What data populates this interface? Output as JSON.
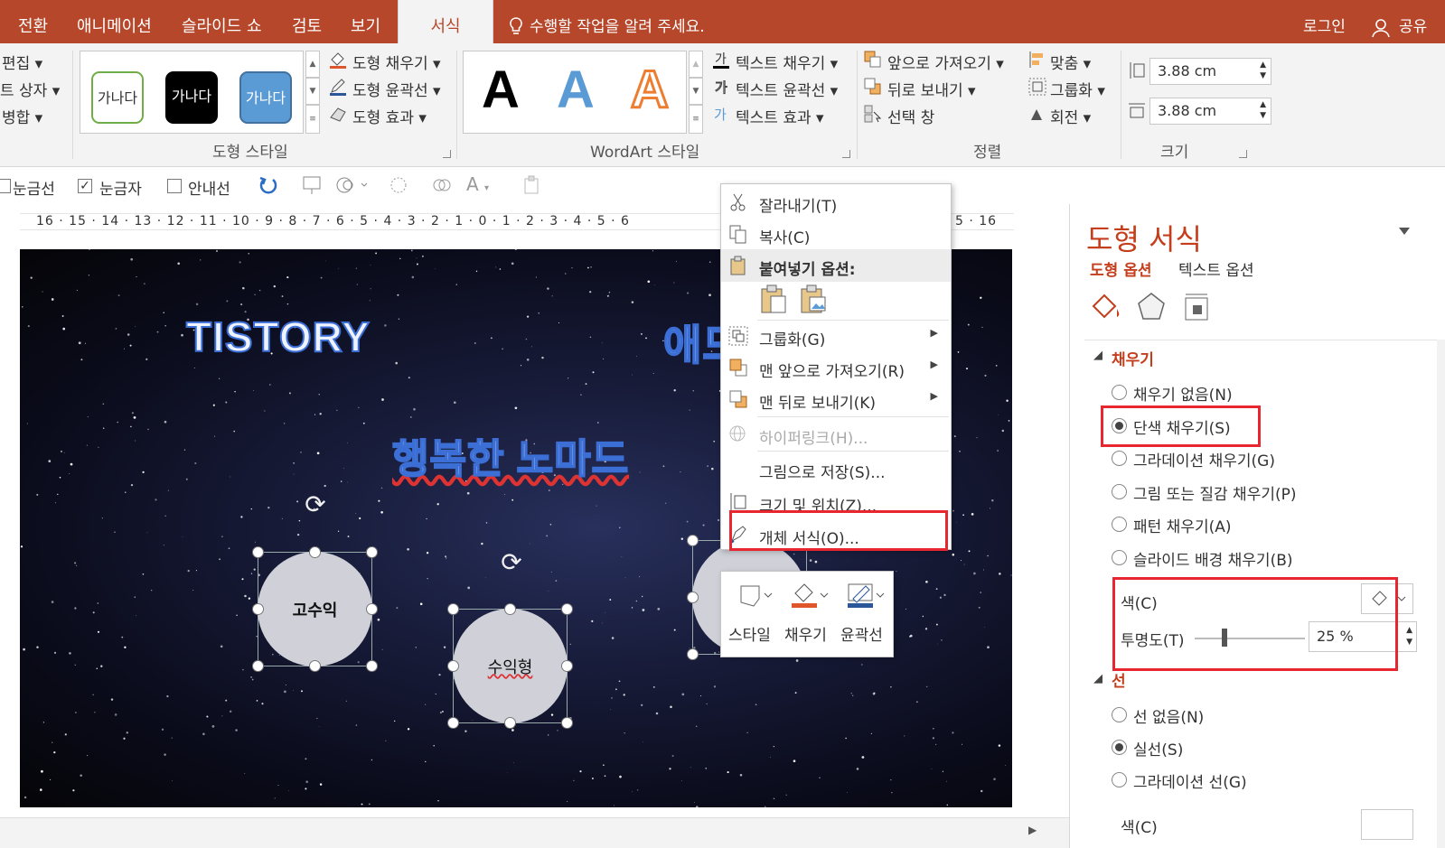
{
  "tabs": [
    "전환",
    "애니메이션",
    "슬라이드 쇼",
    "검토",
    "보기",
    "서식"
  ],
  "tell_me": "수행할 작업을 알려 주세요.",
  "login": "로그인",
  "share": "공유",
  "ribbon": {
    "left_items": [
      "편집",
      "트 상자",
      "병합"
    ],
    "shape_style_samples": [
      "가나다",
      "가나다",
      "가나다"
    ],
    "shape_cmds": [
      "도형 채우기",
      "도형 윤곽선",
      "도형 효과"
    ],
    "shape_style_label": "도형 스타일",
    "wordart_letter": "A",
    "text_cmds": [
      "텍스트 채우기",
      "텍스트 윤곽선",
      "텍스트 효과"
    ],
    "wordart_label": "WordArt 스타일",
    "arrange_cmds": [
      "앞으로 가져오기",
      "뒤로 보내기",
      "선택 창"
    ],
    "arrange_cmds2": [
      "맞춤",
      "그룹화",
      "회전"
    ],
    "arrange_label": "정렬",
    "height_value": "3.88 cm",
    "width_value": "3.88 cm",
    "size_label": "크기"
  },
  "toolbar2": {
    "gridlines": "눈금선",
    "ruler": "눈금자",
    "guides": "안내선"
  },
  "ruler_text": "16 · 15 · 14 · 13 · 12 · 11 · 10 · 9 · 8 · 7 · 6 · 5 · 4 · 3 · 2 · 1 · 0 · 1 · 2 · 3 · 4 · 5 · 6",
  "ruler_right": "5 · 16",
  "slide": {
    "title_left": "TISTORY",
    "title_right": "애드",
    "subtitle": "행복한 노마드",
    "circle1": "고수익",
    "circle2": "수익형"
  },
  "context_menu": {
    "cut": "잘라내기(T)",
    "copy": "복사(C)",
    "paste_options": "붙여넣기 옵션:",
    "group": "그룹화(G)",
    "bring_front": "맨 앞으로 가져오기(R)",
    "send_back": "맨 뒤로 보내기(K)",
    "hyperlink": "하이퍼링크(H)...",
    "save_picture": "그림으로 저장(S)...",
    "size_position": "크기 및 위치(Z)...",
    "format_object": "개체 서식(O)..."
  },
  "mini_toolbar": [
    "스타일",
    "채우기",
    "윤곽선"
  ],
  "pane": {
    "title": "도형 서식",
    "tab_shape": "도형 옵션",
    "tab_text": "텍스트 옵션",
    "fill_section": "채우기",
    "fill_options": [
      "채우기 없음(N)",
      "단색 채우기(S)",
      "그라데이션 채우기(G)",
      "그림 또는 질감 채우기(P)",
      "패턴 채우기(A)",
      "슬라이드 배경 채우기(B)"
    ],
    "color_label": "색(C)",
    "transparency_label": "투명도(T)",
    "transparency_value": "25 %",
    "line_section": "선",
    "line_options": [
      "선 없음(N)",
      "실선(S)",
      "그라데이션 선(G)"
    ],
    "line_color_label": "색(C)"
  },
  "colors": {
    "accent": "#b7472a",
    "highlight_red": "#e8262f"
  }
}
